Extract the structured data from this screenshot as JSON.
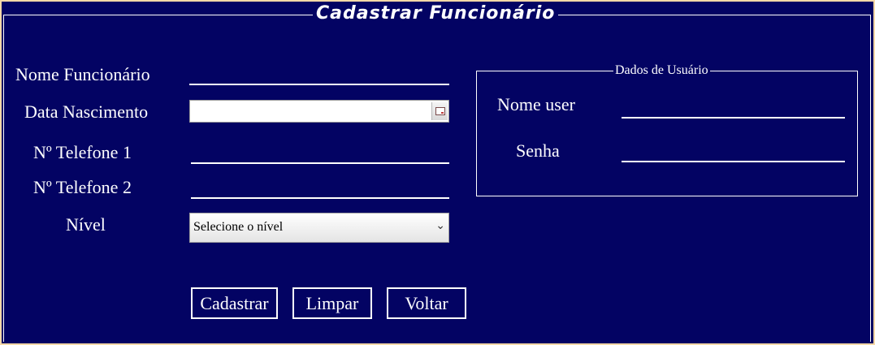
{
  "form": {
    "title": "Cadastrar Funcionário",
    "labels": {
      "nome": "Nome Funcionário",
      "nascimento": "Data Nascimento",
      "telefone1": "Nº Telefone 1",
      "telefone2": "Nº Telefone 2",
      "nivel": "Nível"
    },
    "values": {
      "nome": "",
      "nascimento": "",
      "telefone1": "",
      "telefone2": ""
    },
    "nivel_select": {
      "selected": "Selecione o nível"
    },
    "buttons": {
      "cadastrar": "Cadastrar",
      "limpar": "Limpar",
      "voltar": "Voltar"
    }
  },
  "user_section": {
    "legend": "Dados de Usuário",
    "labels": {
      "nome_user": "Nome user",
      "senha": "Senha"
    },
    "values": {
      "nome_user": "",
      "senha": ""
    }
  },
  "colors": {
    "background": "#030363",
    "foreground": "#ffffff",
    "frame_border": "#f5d8a8"
  },
  "icons": {
    "date_picker": "calendar-icon",
    "select_arrow": "chevron-down-icon"
  }
}
